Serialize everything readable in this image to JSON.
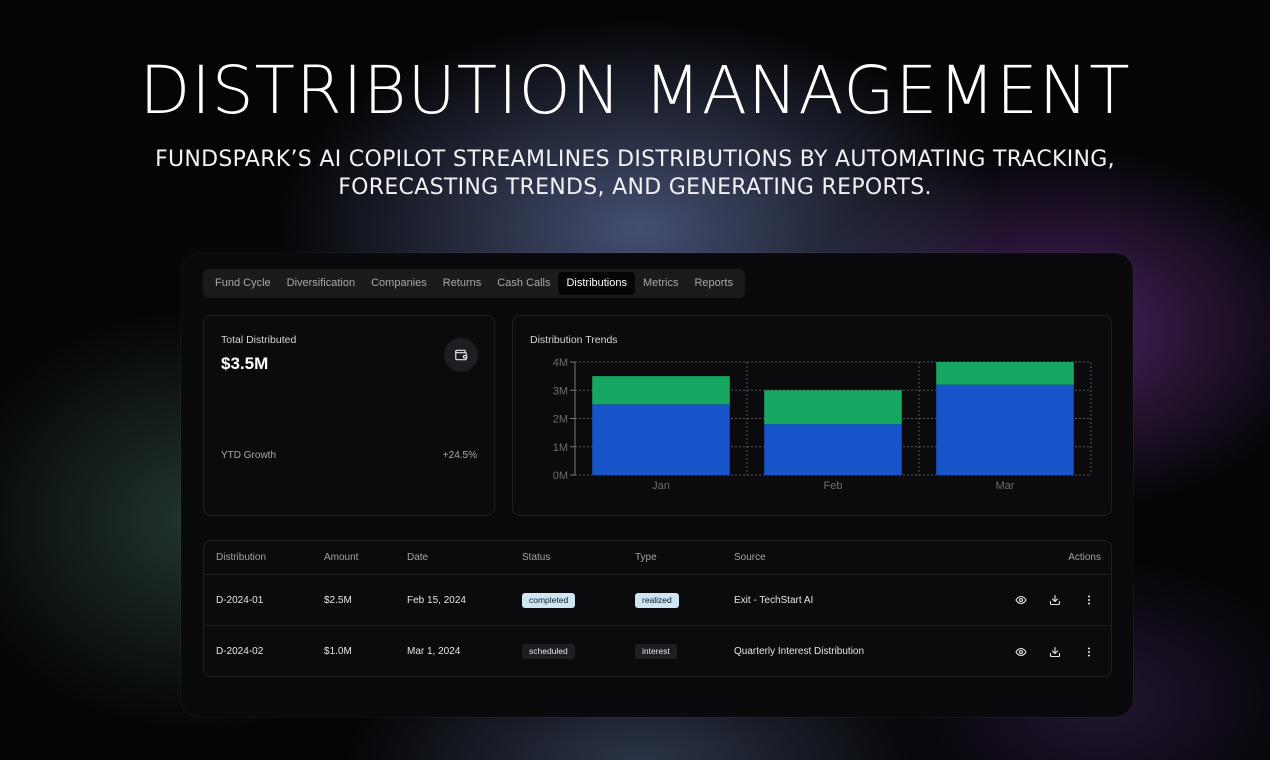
{
  "hero": {
    "title": "DISTRIBUTION MANAGEMENT",
    "subtitle_line1": "FUNDSPARK’S AI COPILOT STREAMLINES DISTRIBUTIONS BY AUTOMATING TRACKING,",
    "subtitle_line2": "FORECASTING TRENDS, AND GENERATING REPORTS."
  },
  "tabs": [
    {
      "label": "Fund Cycle",
      "active": false
    },
    {
      "label": "Diversification",
      "active": false
    },
    {
      "label": "Companies",
      "active": false
    },
    {
      "label": "Returns",
      "active": false
    },
    {
      "label": "Cash Calls",
      "active": false
    },
    {
      "label": "Distributions",
      "active": true
    },
    {
      "label": "Metrics",
      "active": false
    },
    {
      "label": "Reports",
      "active": false
    }
  ],
  "total_card": {
    "label": "Total Distributed",
    "value": "$3.5M",
    "growth_label": "YTD Growth",
    "growth_value": "+24.5%",
    "icon": "wallet-icon"
  },
  "trend_card": {
    "label": "Distribution Trends"
  },
  "chart_data": {
    "type": "bar",
    "stacked": true,
    "categories": [
      "Jan",
      "Feb",
      "Mar"
    ],
    "series": [
      {
        "values": [
          2.5,
          1.8,
          3.2
        ],
        "color": "#1753c9"
      },
      {
        "values": [
          1.0,
          1.2,
          0.8
        ],
        "color": "#16a862"
      }
    ],
    "ylim": [
      0,
      4
    ],
    "yticks": [
      "0M",
      "1M",
      "2M",
      "3M",
      "4M"
    ],
    "grid": true
  },
  "table": {
    "headers": [
      "Distribution",
      "Amount",
      "Date",
      "Status",
      "Type",
      "Source",
      "Actions"
    ],
    "rows": [
      {
        "id": "D-2024-01",
        "amount": "$2.5M",
        "date": "Feb 15, 2024",
        "status": "completed",
        "type": "realized",
        "source": "Exit - TechStart AI"
      },
      {
        "id": "D-2024-02",
        "amount": "$1.0M",
        "date": "Mar 1, 2024",
        "status": "scheduled",
        "type": "interest",
        "source": "Quarterly Interest Distribution"
      }
    ]
  },
  "colors": {
    "accent_blue": "#1753c9",
    "accent_green": "#16a862",
    "badge_light": "#cfe6f2"
  }
}
